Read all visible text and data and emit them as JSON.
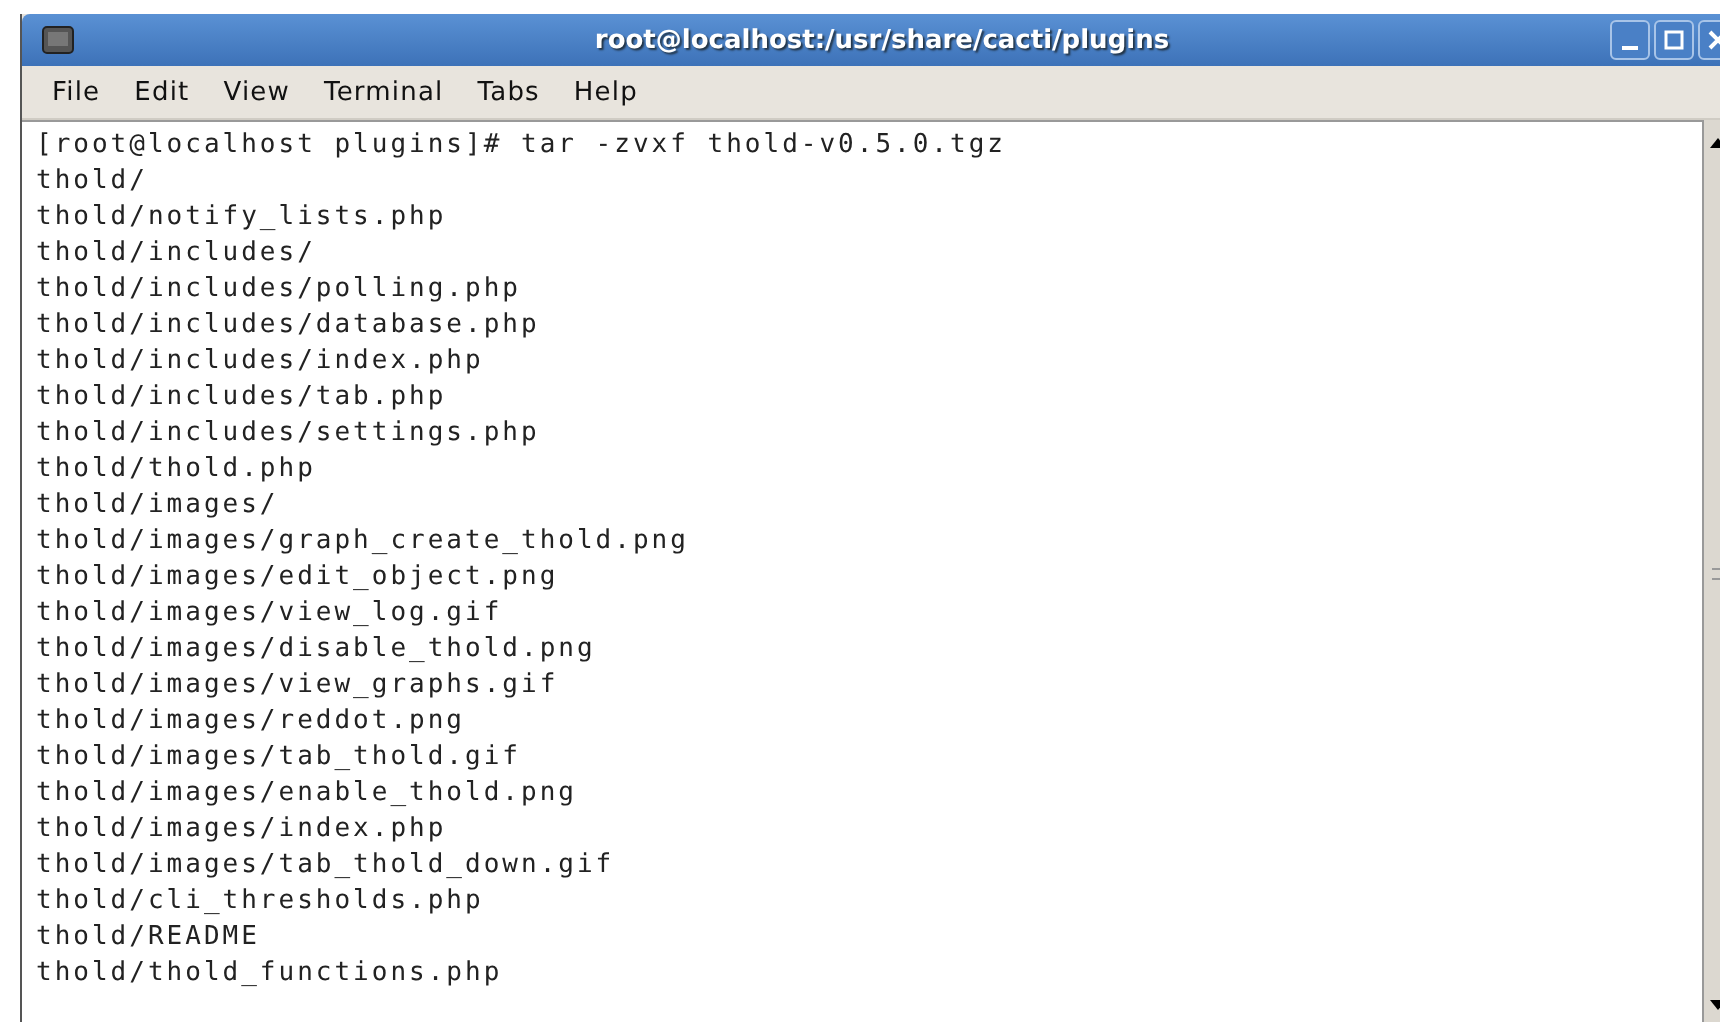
{
  "window": {
    "title": "root@localhost:/usr/share/cacti/plugins"
  },
  "menu": [
    "File",
    "Edit",
    "View",
    "Terminal",
    "Tabs",
    "Help"
  ],
  "terminal": {
    "lines": [
      "[root@localhost plugins]# tar -zvxf thold-v0.5.0.tgz",
      "thold/",
      "thold/notify_lists.php",
      "thold/includes/",
      "thold/includes/polling.php",
      "thold/includes/database.php",
      "thold/includes/index.php",
      "thold/includes/tab.php",
      "thold/includes/settings.php",
      "thold/thold.php",
      "thold/images/",
      "thold/images/graph_create_thold.png",
      "thold/images/edit_object.png",
      "thold/images/view_log.gif",
      "thold/images/disable_thold.png",
      "thold/images/view_graphs.gif",
      "thold/images/reddot.png",
      "thold/images/tab_thold.gif",
      "thold/images/enable_thold.png",
      "thold/images/index.php",
      "thold/images/tab_thold_down.gif",
      "thold/cli_thresholds.php",
      "thold/README",
      "thold/thold_functions.php"
    ]
  }
}
